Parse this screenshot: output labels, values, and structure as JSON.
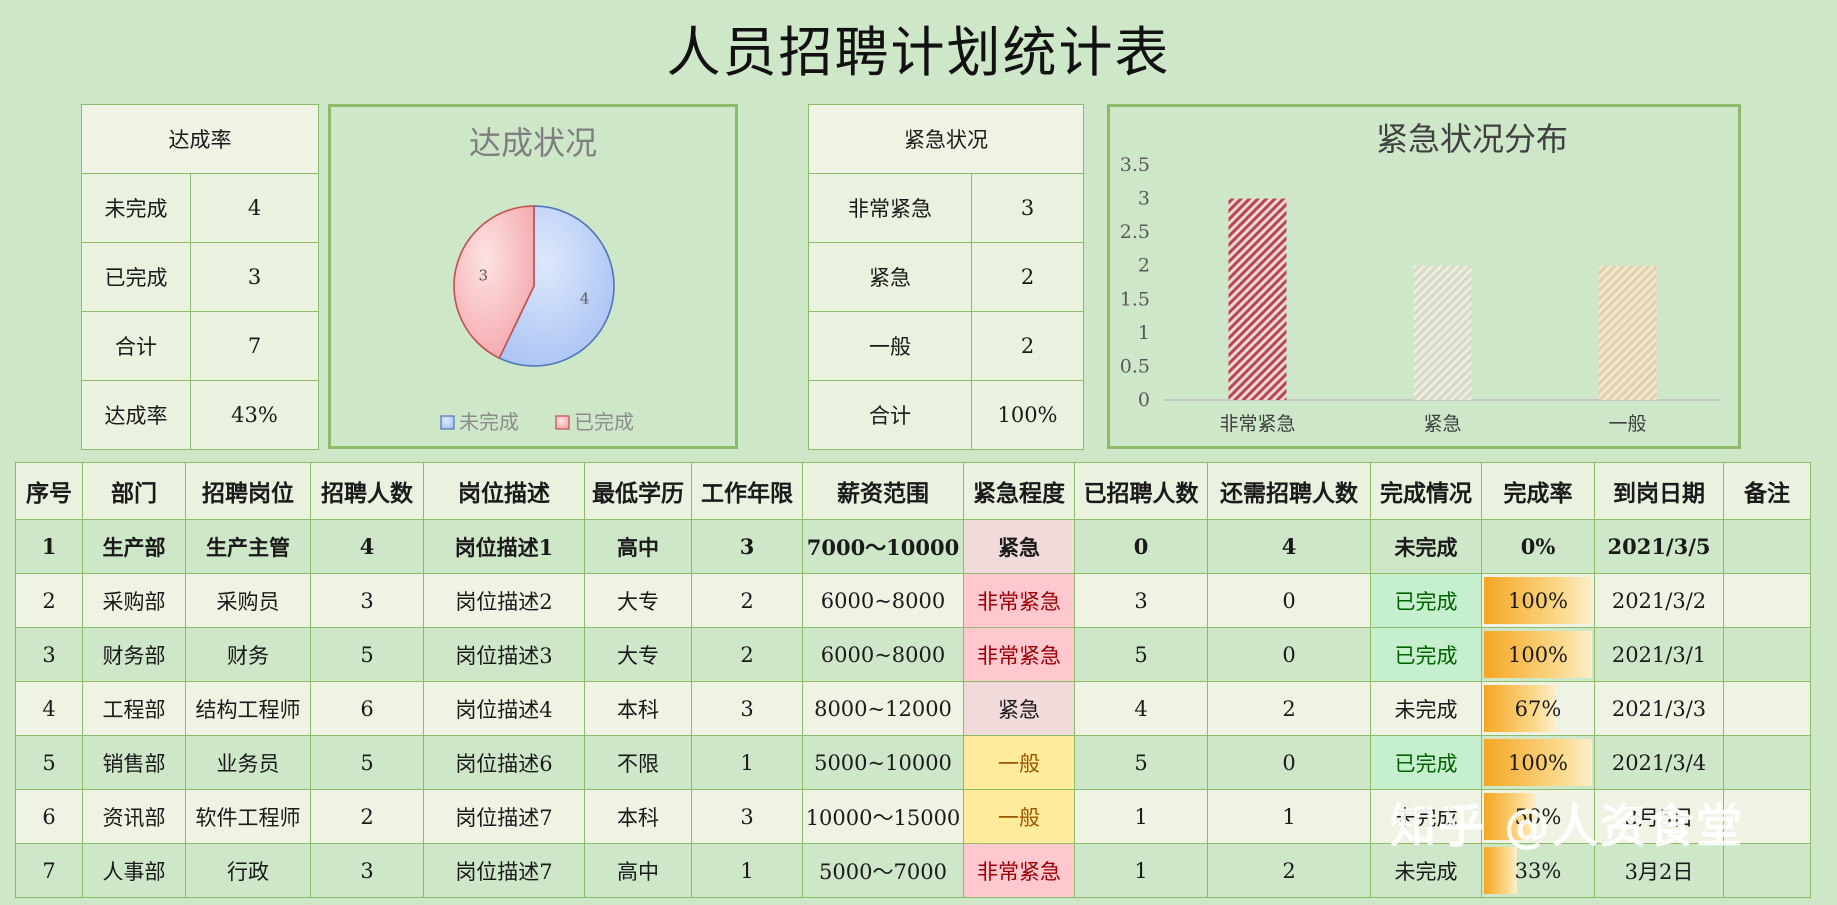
{
  "title": "人员招聘计划统计表",
  "achievement": {
    "header": "达成率",
    "rows": [
      {
        "label": "未完成",
        "value": "4"
      },
      {
        "label": "已完成",
        "value": "3"
      },
      {
        "label": "合计",
        "value": "7"
      },
      {
        "label": "达成率",
        "value": "43%"
      }
    ]
  },
  "urgency": {
    "header": "紧急状况",
    "rows": [
      {
        "label": "非常紧急",
        "value": "3"
      },
      {
        "label": "紧急",
        "value": "2"
      },
      {
        "label": "一般",
        "value": "2"
      },
      {
        "label": "合计",
        "value": "100%"
      }
    ]
  },
  "chart_data": [
    {
      "type": "pie",
      "title": "达成状况",
      "labels": [
        "未完成",
        "已完成"
      ],
      "values": [
        4,
        3
      ],
      "colors": [
        "#a9c4f5",
        "#f5a9ad"
      ],
      "legend": "bottom"
    },
    {
      "type": "bar",
      "title": "紧急状况分布",
      "categories": [
        "非常紧急",
        "紧急",
        "一般"
      ],
      "values": [
        3,
        2,
        2
      ],
      "ylim": [
        0,
        3.5
      ],
      "yticks": [
        "0",
        "0.5",
        "1",
        "1.5",
        "2",
        "2.5",
        "3",
        "3.5"
      ],
      "colors": [
        "#b5484f",
        "#d9d9c8",
        "#e8d6b8"
      ],
      "grid": false
    }
  ],
  "table": {
    "headers": [
      "序号",
      "部门",
      "招聘岗位",
      "招聘人数",
      "岗位描述",
      "最低学历",
      "工作年限",
      "薪资范围",
      "紧急程度",
      "已招聘人数",
      "还需招聘人数",
      "完成情况",
      "完成率",
      "到岗日期",
      "备注"
    ],
    "rows": [
      {
        "no": "1",
        "dept": "生产部",
        "pos": "生产主管",
        "count": "4",
        "desc": "岗位描述1",
        "edu": "高中",
        "years": "3",
        "salary": "7000～10000",
        "urgency": "紧急",
        "ulevel": "urg",
        "hired": "0",
        "need": "4",
        "status": "未完成",
        "done": false,
        "rate": "0%",
        "rate_val": 0,
        "date": "2021/3/5",
        "note": ""
      },
      {
        "no": "2",
        "dept": "采购部",
        "pos": "采购员",
        "count": "3",
        "desc": "岗位描述2",
        "edu": "大专",
        "years": "2",
        "salary": "6000~8000",
        "urgency": "非常紧急",
        "ulevel": "very",
        "hired": "3",
        "need": "0",
        "status": "已完成",
        "done": true,
        "rate": "100%",
        "rate_val": 1,
        "date": "2021/3/2",
        "note": ""
      },
      {
        "no": "3",
        "dept": "财务部",
        "pos": "财务",
        "count": "5",
        "desc": "岗位描述3",
        "edu": "大专",
        "years": "2",
        "salary": "6000~8000",
        "urgency": "非常紧急",
        "ulevel": "very",
        "hired": "5",
        "need": "0",
        "status": "已完成",
        "done": true,
        "rate": "100%",
        "rate_val": 1,
        "date": "2021/3/1",
        "note": ""
      },
      {
        "no": "4",
        "dept": "工程部",
        "pos": "结构工程师",
        "count": "6",
        "desc": "岗位描述4",
        "edu": "本科",
        "years": "3",
        "salary": "8000~12000",
        "urgency": "紧急",
        "ulevel": "urg",
        "hired": "4",
        "need": "2",
        "status": "未完成",
        "done": false,
        "rate": "67%",
        "rate_val": 0.67,
        "date": "2021/3/3",
        "note": ""
      },
      {
        "no": "5",
        "dept": "销售部",
        "pos": "业务员",
        "count": "5",
        "desc": "岗位描述6",
        "edu": "不限",
        "years": "1",
        "salary": "5000~10000",
        "urgency": "一般",
        "ulevel": "gen",
        "hired": "5",
        "need": "0",
        "status": "已完成",
        "done": true,
        "rate": "100%",
        "rate_val": 1,
        "date": "2021/3/4",
        "note": ""
      },
      {
        "no": "6",
        "dept": "资讯部",
        "pos": "软件工程师",
        "count": "2",
        "desc": "岗位描述7",
        "edu": "本科",
        "years": "3",
        "salary": "10000～15000",
        "urgency": "一般",
        "ulevel": "gen",
        "hired": "1",
        "need": "1",
        "status": "未完成",
        "done": false,
        "rate": "50%",
        "rate_val": 0.5,
        "date": "3月5日",
        "note": ""
      },
      {
        "no": "7",
        "dept": "人事部",
        "pos": "行政",
        "count": "3",
        "desc": "岗位描述7",
        "edu": "高中",
        "years": "1",
        "salary": "5000～7000",
        "urgency": "非常紧急",
        "ulevel": "very",
        "hired": "1",
        "need": "2",
        "status": "未完成",
        "done": false,
        "rate": "33%",
        "rate_val": 0.33,
        "date": "3月2日",
        "note": ""
      }
    ]
  },
  "watermark": "知乎 @人资食堂"
}
